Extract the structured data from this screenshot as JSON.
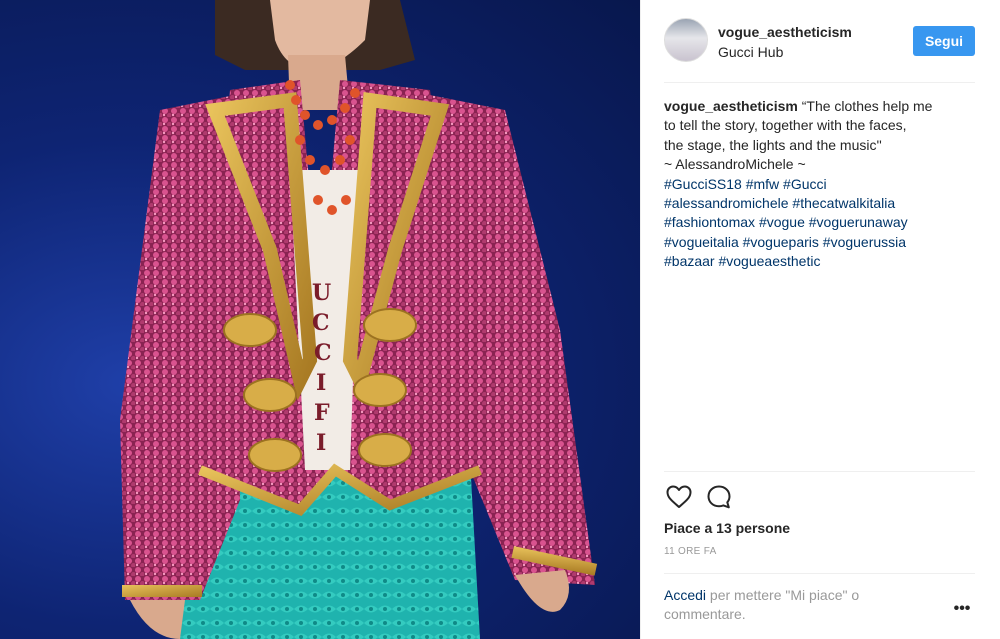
{
  "post": {
    "header": {
      "username": "vogue_aestheticism",
      "location": "Gucci Hub",
      "follow_label": "Segui"
    },
    "caption": {
      "username": "vogue_aestheticism",
      "lines": [
        "“The clothes help me",
        "to tell the story, together with the faces,",
        "the stage, the lights and the music''",
        "~ AlessandroMichele ~"
      ],
      "hashtag_lines": [
        "#GucciSS18 #mfw #Gucci",
        "#alessandromichele #thecatwalkitalia",
        "#fashiontomax #vogue #voguerunaway",
        "#vogueitalia #vogueparis #voguerussia",
        "#bazaar #vogueaesthetic"
      ]
    },
    "likes_text": "Piace a 13 persone",
    "time_text": "11 ORE FA",
    "login_prompt": {
      "link_text": "Accedi",
      "rest_line1": " per mettere \"Mi piace\" o",
      "rest_line2": "commentare."
    },
    "more_label": "•••"
  },
  "icons": {
    "like": "heart-icon",
    "comment": "comment-icon",
    "more": "more-options-icon"
  },
  "colors": {
    "follow_button": "#3897f0",
    "hashtag": "#003569",
    "muted": "#999999",
    "text": "#262626"
  }
}
